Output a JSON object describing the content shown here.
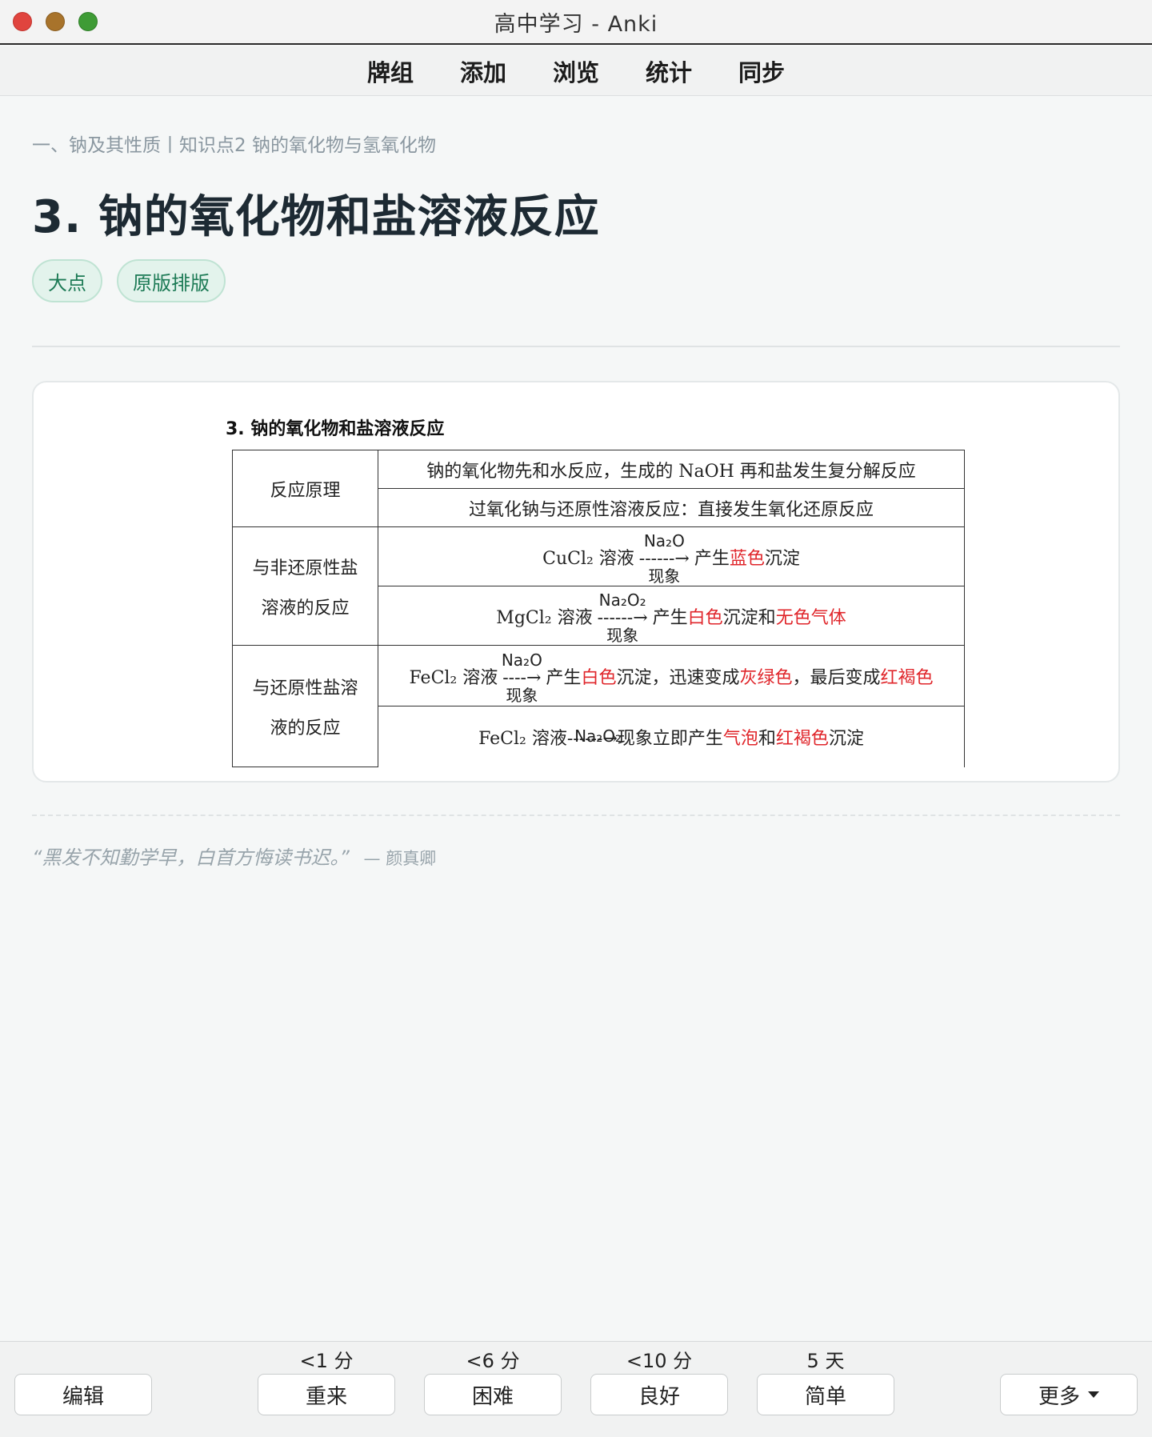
{
  "window": {
    "title": "高中学习 - Anki"
  },
  "menu": {
    "items": [
      "牌组",
      "添加",
      "浏览",
      "统计",
      "同步"
    ]
  },
  "card": {
    "breadcrumb": "一、钠及其性质丨知识点2 钠的氧化物与氢氧化物",
    "title": "3.  钠的氧化物和盐溶液反应",
    "tags": [
      "大点",
      "原版排版"
    ],
    "image": {
      "heading": "3.  钠的氧化物和盐溶液反应",
      "row1_label": "反应原理",
      "row1a": "钠的氧化物先和水反应，生成的 NaOH 再和盐发生复分解反应",
      "row1b": "过氧化钠与还原性溶液反应：直接发生氧化还原反应",
      "group2_label_1": "与非还原性盐",
      "group2_label_2": "溶液的反应",
      "group3_label_1": "与还原性盐溶",
      "group3_label_2": "液的反应",
      "r2_salt": "CuCl₂ 溶液",
      "r2_reagent": "Na₂O",
      "r2_phen": "现象",
      "r2_result1": "产生",
      "r2_red1": "蓝色",
      "r2_result2": "沉淀",
      "r3_salt": "MgCl₂ 溶液",
      "r3_reagent": "Na₂O₂",
      "r3_phen": "现象",
      "r3_result1": "产生",
      "r3_red1": "白色",
      "r3_result2": "沉淀和",
      "r3_red2": "无色气体",
      "r4_salt": "FeCl₂ 溶液",
      "r4_reagent": "Na₂O",
      "r4_phen": "现象",
      "r4_result1": "产生",
      "r4_red1": "白色",
      "r4_result2": "沉淀，迅速变成",
      "r4_red2": "灰绿色",
      "r4_result3": "，最后变成",
      "r4_red3": "红褐色",
      "r5_reagent": "Na₂O₂",
      "r5_salt": "FeCl₂ 溶液------→现象立即产生",
      "r5_red1": "气泡",
      "r5_result1": "和",
      "r5_red2": "红褐色",
      "r5_result2": "沉淀"
    },
    "quote_text": "“黑发不知勤学早，白首方悔读书迟。”",
    "quote_author": "— 颜真卿"
  },
  "bottom": {
    "edit_label": "编辑",
    "more_label": "更多",
    "answers": [
      {
        "interval": "<1 分",
        "label": "重来"
      },
      {
        "interval": "<6 分",
        "label": "困难"
      },
      {
        "interval": "<10 分",
        "label": "良好"
      },
      {
        "interval": "5 天",
        "label": "简单"
      }
    ]
  },
  "colors": {
    "accent_tag": "#1c7a55",
    "tag_bg": "#e3f3ec",
    "highlight_red": "#e0262b"
  }
}
